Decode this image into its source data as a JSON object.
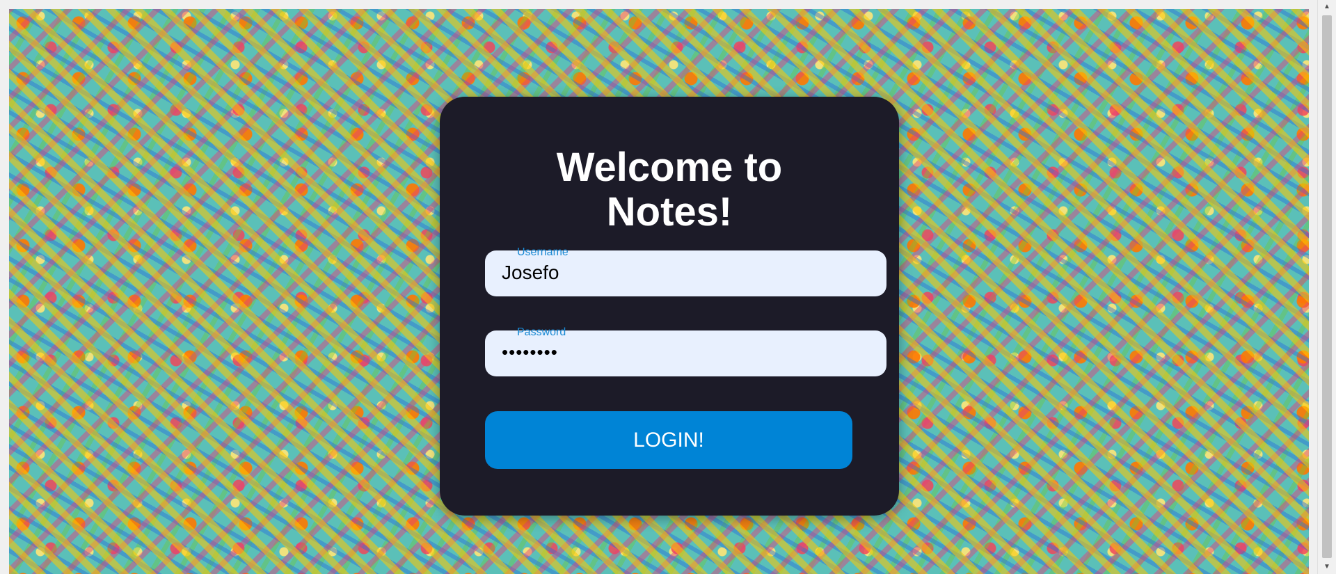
{
  "page": {
    "background_color": "#f0f0f0",
    "card_color": "#1c1b28",
    "accent_color": "#0084d6",
    "field_color": "#e8f0fe"
  },
  "login_card": {
    "title_line_1": "Welcome to",
    "title_line_2": "Notes!",
    "username": {
      "label": "Username",
      "value": "Josefo"
    },
    "password": {
      "label": "Password",
      "value": "••••••••"
    },
    "login_button_label": "LOGIN!"
  },
  "scrollbar": {
    "up_icon": "scroll-up-arrow",
    "down_icon": "scroll-down-arrow",
    "up_glyph": "▲",
    "down_glyph": "▼"
  }
}
